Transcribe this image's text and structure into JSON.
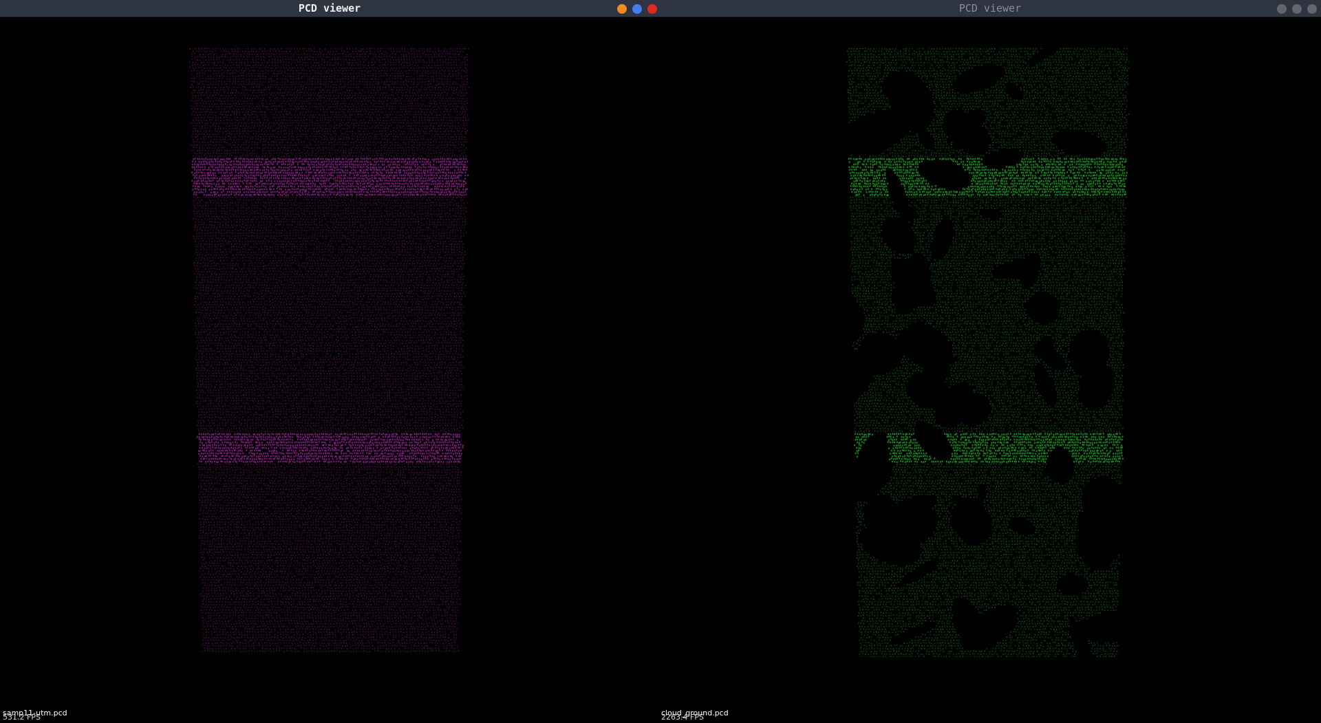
{
  "windows": [
    {
      "title": "PCD viewer",
      "cloud_color": "#b429b4",
      "file_name": "samp11-utm.pcd",
      "fps": "531.2 FPS",
      "controls": [
        "minimize",
        "maximize",
        "close"
      ],
      "control_colors": [
        "#f28a1d",
        "#3e7ff2",
        "#e2291f"
      ]
    },
    {
      "title": "PCD viewer",
      "cloud_color": "#22c52a",
      "file_name": "cloud_ground.pcd",
      "fps": "2263.4 FPS",
      "controls": [
        "minimize",
        "maximize",
        "close"
      ],
      "control_colors": [
        "#62666e",
        "#62666e",
        "#62666e"
      ]
    }
  ]
}
